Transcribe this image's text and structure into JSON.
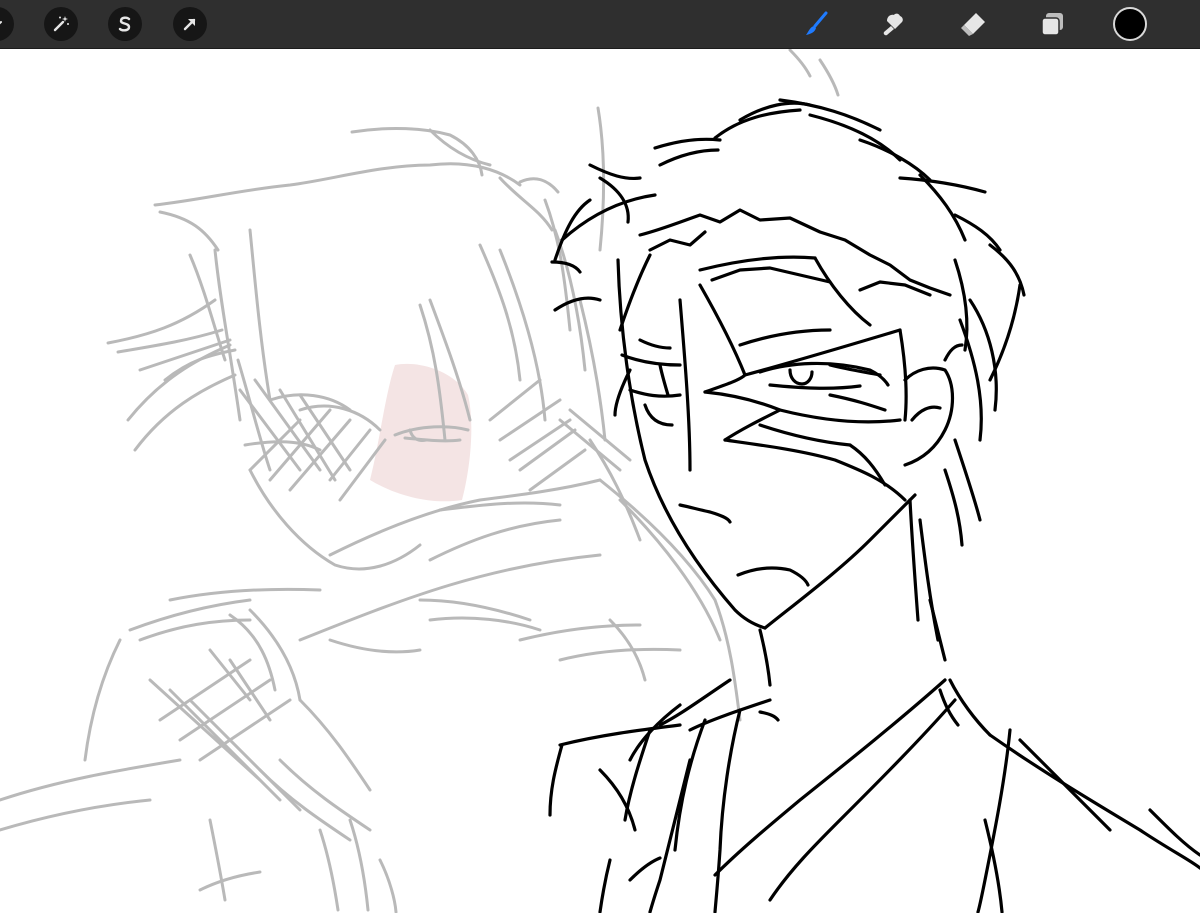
{
  "toolbar": {
    "left_tools": [
      {
        "name": "adjustments-icon"
      },
      {
        "name": "selection-icon"
      },
      {
        "name": "transform-icon"
      }
    ],
    "right_tools": [
      {
        "name": "brush-icon",
        "active": true
      },
      {
        "name": "smudge-icon",
        "active": false
      },
      {
        "name": "eraser-icon",
        "active": false
      },
      {
        "name": "layers-icon",
        "active": false
      }
    ]
  },
  "colors": {
    "toolbar_bg": "#2f2f2f",
    "icon": "#e6e6e6",
    "active_tool": "#1f7bff",
    "current_color": "#000000",
    "sketch_gray": "#b9b9b9",
    "ink": "#000000",
    "blush": "#f4e4e4"
  }
}
